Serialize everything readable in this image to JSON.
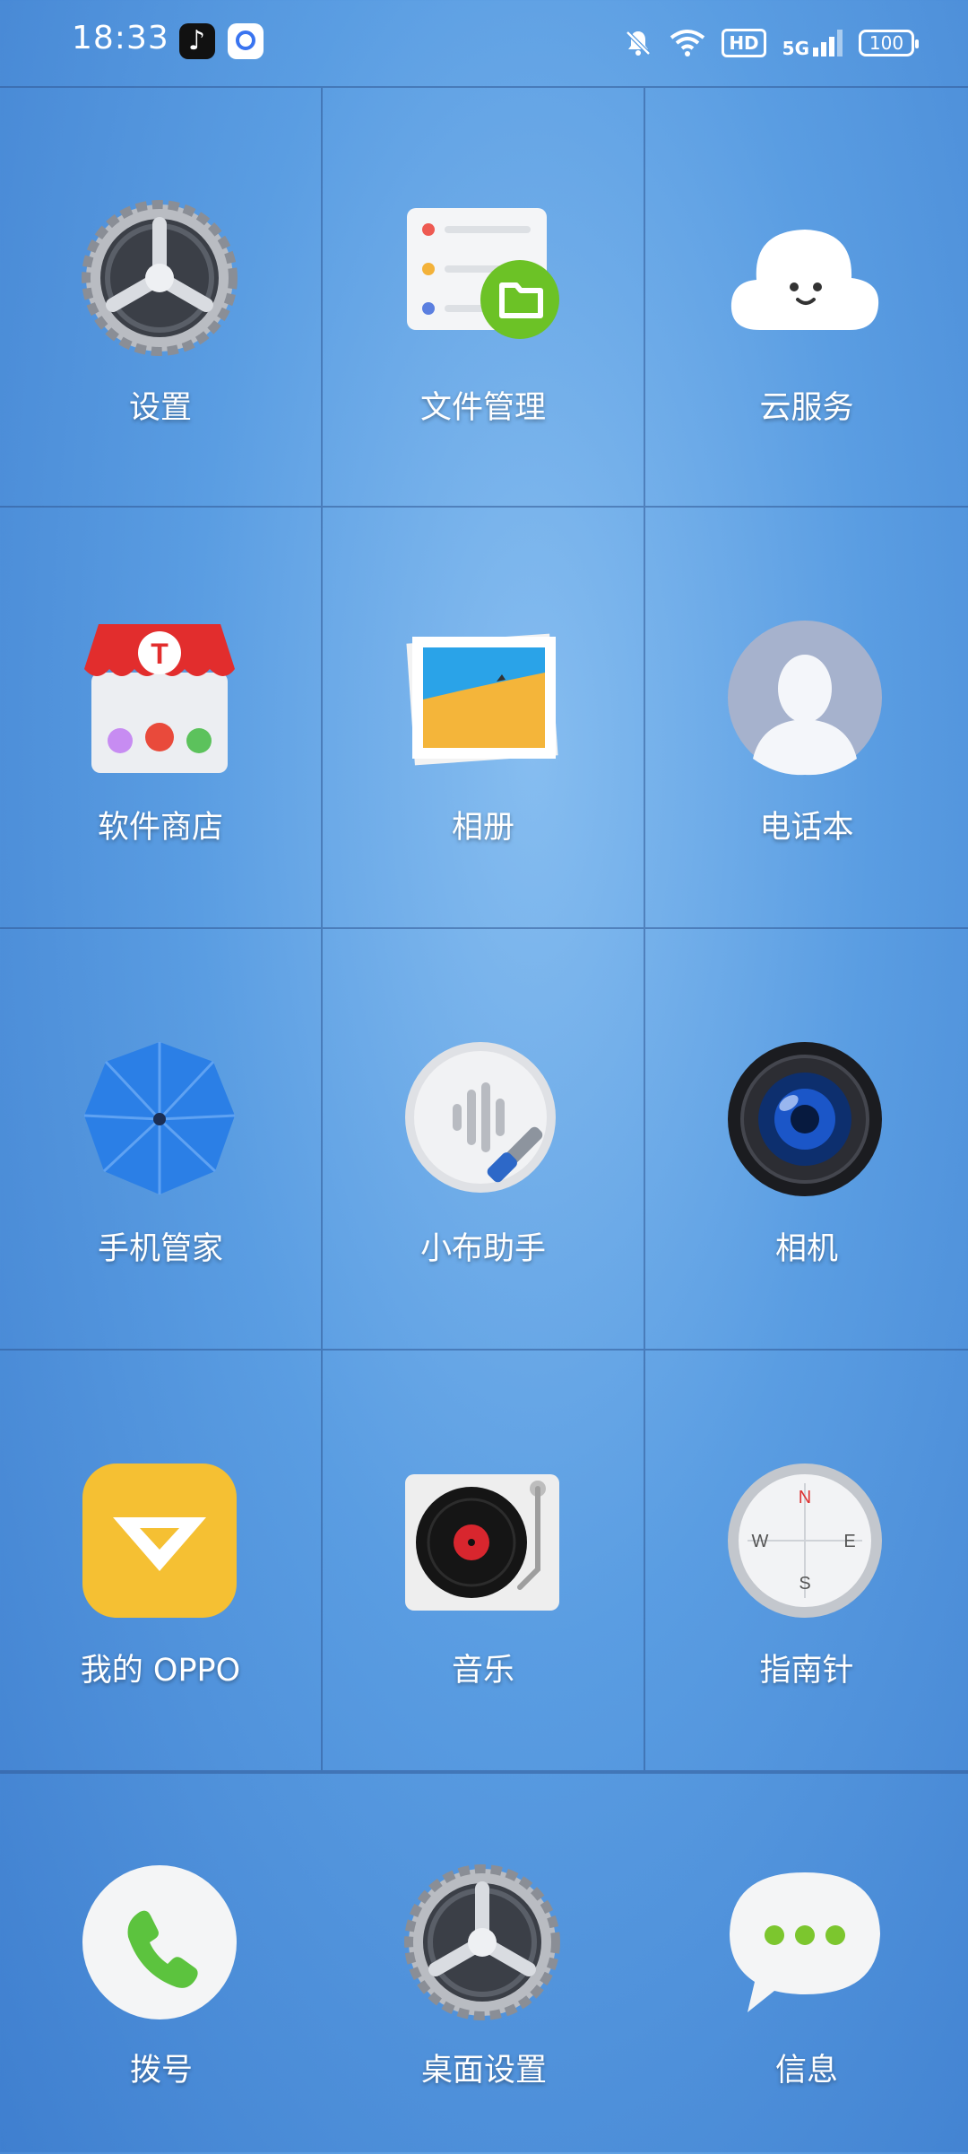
{
  "status_bar": {
    "time": "18:33",
    "apps": [
      "tiktok-icon",
      "baidu-netdisk-icon"
    ],
    "icons": [
      "bell-muted-icon",
      "wifi-icon",
      "hd-badge",
      "5g-signal-icon",
      "battery-icon"
    ],
    "hd": "HD",
    "network": "5G",
    "battery": "100"
  },
  "apps": [
    {
      "label": "设置",
      "icon": "settings-gear-icon"
    },
    {
      "label": "文件管理",
      "icon": "file-manager-icon"
    },
    {
      "label": "云服务",
      "icon": "cloud-icon"
    },
    {
      "label": "软件商店",
      "icon": "app-store-icon"
    },
    {
      "label": "相册",
      "icon": "photos-icon"
    },
    {
      "label": "电话本",
      "icon": "contacts-icon"
    },
    {
      "label": "手机管家",
      "icon": "umbrella-icon"
    },
    {
      "label": "小布助手",
      "icon": "assistant-icon"
    },
    {
      "label": "相机",
      "icon": "camera-lens-icon"
    },
    {
      "label": "我的 OPPO",
      "icon": "my-oppo-icon"
    },
    {
      "label": "音乐",
      "icon": "turntable-icon"
    },
    {
      "label": "指南针",
      "icon": "compass-icon"
    }
  ],
  "dock": [
    {
      "label": "拨号",
      "icon": "phone-icon"
    },
    {
      "label": "桌面设置",
      "icon": "settings-gear-icon"
    },
    {
      "label": "信息",
      "icon": "message-icon"
    }
  ],
  "compass_letters": [
    "N",
    "E",
    "S",
    "W"
  ],
  "store_letter": "T",
  "colors": {
    "background": "#5a9de2",
    "grid_line": "#325a96",
    "label": "#ffffff"
  }
}
